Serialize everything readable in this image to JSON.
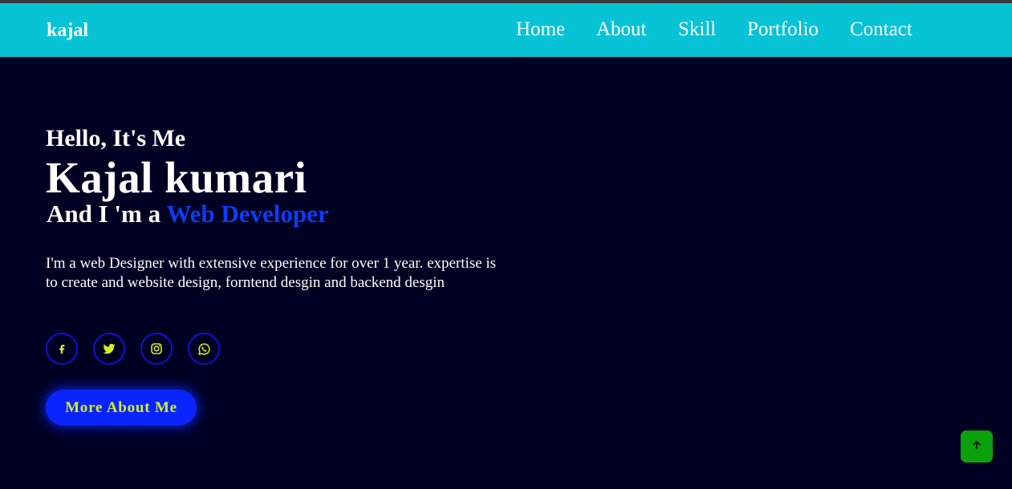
{
  "navbar": {
    "brand": "kajal",
    "links": [
      "Home",
      "About",
      "Skill",
      "Portfolio",
      "Contact"
    ]
  },
  "hero": {
    "greeting": "Hello, It's Me",
    "name": "Kajal kumari",
    "role_prefix": "And I 'm a ",
    "role_highlight": "Web Developer",
    "description": "I'm a web Designer with extensive experience for over 1 year. expertise is to create and website design, forntend desgin and backend desgin",
    "social_icons": [
      "facebook-icon",
      "twitter-icon",
      "instagram-icon",
      "whatsapp-icon"
    ],
    "cta_label": "More About Me"
  },
  "scroll_top_icon": "arrow-up-icon",
  "colors": {
    "navbar_bg": "#08c2d6",
    "page_bg": "#000022",
    "accent_blue": "#0b3cf5",
    "button_bg": "#0a24ff",
    "button_text": "#d6f021",
    "icon_yellow": "#d6f021",
    "scroll_top_bg": "#0aa10a"
  }
}
